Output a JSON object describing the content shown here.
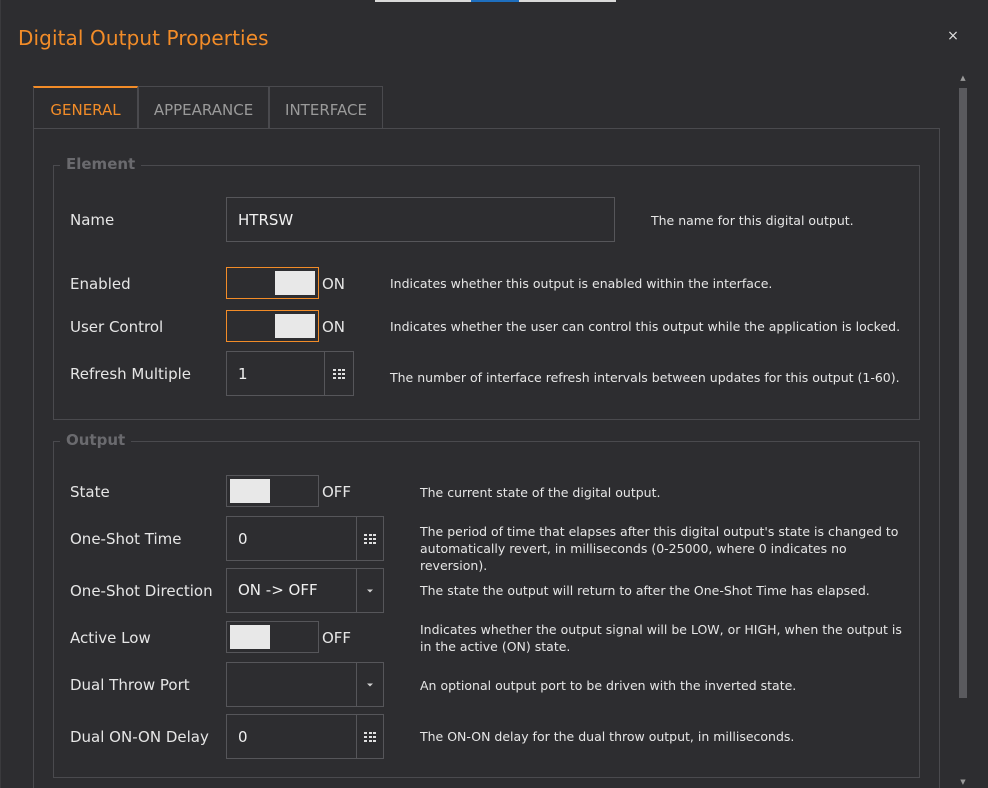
{
  "window": {
    "title": "Digital Output Properties",
    "close_glyph": "×"
  },
  "tabs": [
    {
      "label": "GENERAL",
      "active": true
    },
    {
      "label": "APPEARANCE",
      "active": false
    },
    {
      "label": "INTERFACE",
      "active": false
    }
  ],
  "element_group": {
    "title": "Element",
    "name": {
      "label": "Name",
      "value": "HTRSW",
      "desc": "The name for this digital output."
    },
    "enabled": {
      "label": "Enabled",
      "state": "ON",
      "desc": "Indicates whether this output is enabled within the interface."
    },
    "user_control": {
      "label": "User Control",
      "state": "ON",
      "desc": "Indicates whether the user can control this output while the application is locked."
    },
    "refresh_multiple": {
      "label": "Refresh Multiple",
      "value": "1",
      "desc": "The number of interface refresh intervals between updates for this output (1-60)."
    }
  },
  "output_group": {
    "title": "Output",
    "state": {
      "label": "State",
      "state": "OFF",
      "desc": "The current state of the digital output."
    },
    "one_shot_time": {
      "label": "One-Shot Time",
      "value": "0",
      "desc": "The period of time that elapses after this digital output's state is changed to automatically revert, in milliseconds (0-25000, where 0 indicates no reversion)."
    },
    "one_shot_direction": {
      "label": "One-Shot Direction",
      "value": "ON -> OFF",
      "desc": "The state the output will return to after the One-Shot Time has elapsed."
    },
    "active_low": {
      "label": "Active Low",
      "state": "OFF",
      "desc": "Indicates whether the output signal will be LOW, or HIGH, when the output is in the active (ON) state."
    },
    "dual_throw_port": {
      "label": "Dual Throw Port",
      "value": "",
      "desc": "An optional output port to be driven with the inverted state."
    },
    "dual_on_on_delay": {
      "label": "Dual ON-ON Delay",
      "value": "0",
      "desc": "The ON-ON delay for the dual throw output, in milliseconds."
    }
  },
  "colors": {
    "accent": "#f28c28",
    "background": "#2d2d30",
    "border": "#56565a"
  }
}
